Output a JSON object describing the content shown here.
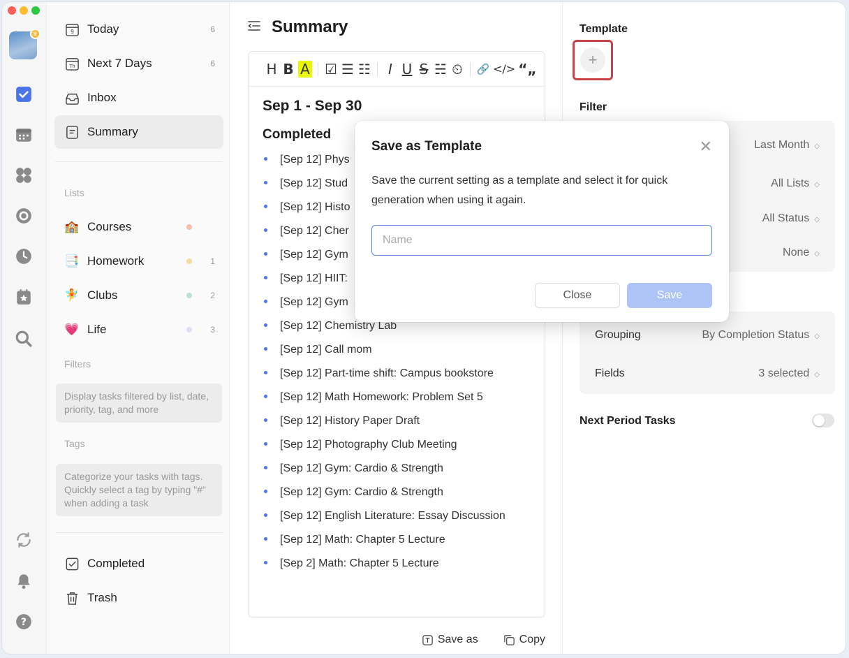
{
  "rail": {
    "traffic_colors": [
      "#ff5f57",
      "#febc2e",
      "#28c840"
    ],
    "icons": [
      "checkbox-icon",
      "calendar-icon",
      "apps-icon",
      "focus-icon",
      "clock-icon",
      "calendar-star-icon",
      "search-icon",
      "sync-icon",
      "bell-icon",
      "help-icon"
    ]
  },
  "sidebar": {
    "smart": [
      {
        "label": "Today",
        "count": "6",
        "icon": "calendar-day-icon"
      },
      {
        "label": "Next 7 Days",
        "count": "6",
        "icon": "calendar-week-icon"
      },
      {
        "label": "Inbox",
        "count": "",
        "icon": "inbox-icon"
      },
      {
        "label": "Summary",
        "count": "",
        "icon": "summary-icon"
      }
    ],
    "lists_label": "Lists",
    "lists": [
      {
        "emoji": "🏫",
        "label": "Courses",
        "count": "",
        "dot": "#f5c0a8"
      },
      {
        "emoji": "📑",
        "label": "Homework",
        "count": "1",
        "dot": "#f7dca0"
      },
      {
        "emoji": "🧚",
        "label": "Clubs",
        "count": "2",
        "dot": "#bfe0cf"
      },
      {
        "emoji": "💗",
        "label": "Life",
        "count": "3",
        "dot": "#e4dcf5"
      }
    ],
    "filters_label": "Filters",
    "filters_hint": "Display tasks filtered by list, date, priority, tag, and more",
    "tags_label": "Tags",
    "tags_hint": "Categorize your tasks with tags. Quickly select a tag by typing \"#\" when adding a task",
    "completed": "Completed",
    "trash": "Trash"
  },
  "middle": {
    "title": "Summary",
    "toolbar": [
      "H",
      "B",
      "A",
      "☑",
      "☰",
      "☷",
      "I",
      "U",
      "S",
      "☵",
      "⏲",
      "🔗",
      "</>",
      "“„"
    ],
    "doc_title": "Sep 1 - Sep 30",
    "section": "Completed",
    "items": [
      "[Sep 12] Phys",
      "[Sep 12] Stud",
      "[Sep 12] Histo",
      "[Sep 12] Cher",
      "[Sep 12] Gym",
      "[Sep 12] HIIT:",
      "[Sep 12] Gym",
      "[Sep 12] Chemistry Lab",
      "[Sep 12] Call mom",
      "[Sep 12] Part-time shift: Campus bookstore",
      "[Sep 12] Math Homework: Problem Set 5",
      "[Sep 12] History Paper Draft",
      "[Sep 12] Photography Club Meeting",
      "[Sep 12] Gym: Cardio & Strength",
      "[Sep 12] Gym: Cardio & Strength",
      "[Sep 12] English Literature: Essay Discussion",
      "[Sep 12] Math: Chapter 5 Lecture",
      "[Sep 2] Math: Chapter 5 Lecture"
    ],
    "save_as": "Save as",
    "copy": "Copy"
  },
  "right": {
    "template_title": "Template",
    "filter_title": "Filter",
    "filter_rows": [
      {
        "value": "Last Month"
      },
      {
        "value": "All Lists"
      },
      {
        "value": "All Status"
      },
      {
        "value": "None"
      }
    ],
    "display_rows": [
      {
        "label": "Grouping",
        "value": "By Completion Status"
      },
      {
        "label": "Fields",
        "value": "3 selected"
      }
    ],
    "next_period": "Next Period Tasks",
    "next_period_on": false
  },
  "modal": {
    "title": "Save as Template",
    "description": "Save the current setting as a template and select it for quick generation when using it again.",
    "name_placeholder": "Name",
    "name_value": "",
    "close_label": "Close",
    "save_label": "Save"
  },
  "colors": {
    "accent": "#4a74e8",
    "highlight": "#c84448",
    "save_disabled": "#aec3f6"
  }
}
